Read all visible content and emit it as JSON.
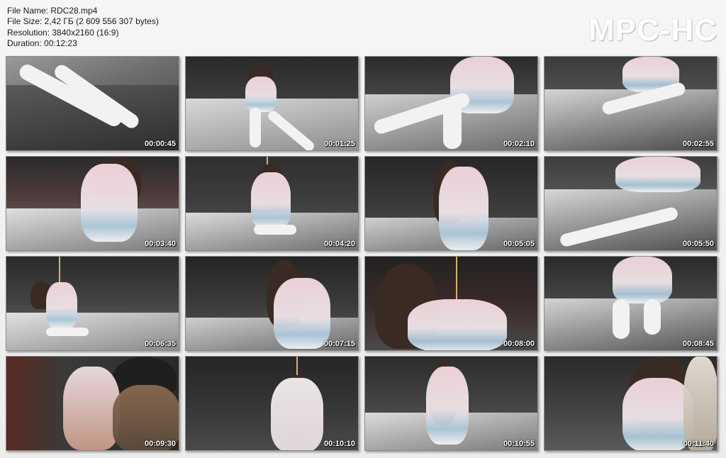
{
  "info": {
    "file_name": "File Name: RDC28.mp4",
    "file_size": "File Size: 2,42 ГБ (2 609 556 307 bytes)",
    "resolution": "Resolution: 3840x2160 (16:9)",
    "duration": "Duration: 00:12:23"
  },
  "logo": "MPC-HC",
  "thumbnails": [
    {
      "time": "00:00:45"
    },
    {
      "time": "00:01:25"
    },
    {
      "time": "00:02:10"
    },
    {
      "time": "00:02:55"
    },
    {
      "time": "00:03:40"
    },
    {
      "time": "00:04:20"
    },
    {
      "time": "00:05:05"
    },
    {
      "time": "00:05:50"
    },
    {
      "time": "00:06:35"
    },
    {
      "time": "00:07:15"
    },
    {
      "time": "00:08:00"
    },
    {
      "time": "00:08:45"
    },
    {
      "time": "00:09:30"
    },
    {
      "time": "00:10:10"
    },
    {
      "time": "00:10:55"
    },
    {
      "time": "00:11:40"
    }
  ]
}
